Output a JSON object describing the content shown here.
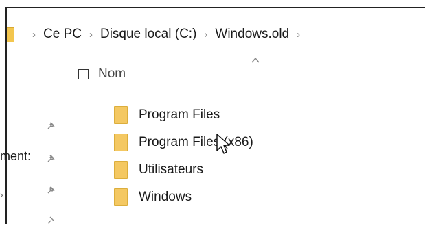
{
  "address_bar": {
    "crumbs": [
      "Ce PC",
      "Disque local (C:)",
      "Windows.old"
    ],
    "separator": "›"
  },
  "column_header": {
    "name_label": "Nom",
    "sort_indicator": "ascending"
  },
  "files": [
    {
      "name": "Program Files",
      "type": "folder"
    },
    {
      "name": "Program Files (x86)",
      "type": "folder"
    },
    {
      "name": "Utilisateurs",
      "type": "folder"
    },
    {
      "name": "Windows",
      "type": "folder"
    }
  ],
  "navigation_pane": {
    "truncated_label": "ment:"
  },
  "colors": {
    "folder": "#f4c862",
    "folder_border": "#dcae3c",
    "text": "#1a1a1a",
    "pin": "#8a8a8a"
  },
  "icons": {
    "pin": "pin-icon",
    "folder": "folder-icon",
    "cursor": "mouse-cursor-icon"
  }
}
